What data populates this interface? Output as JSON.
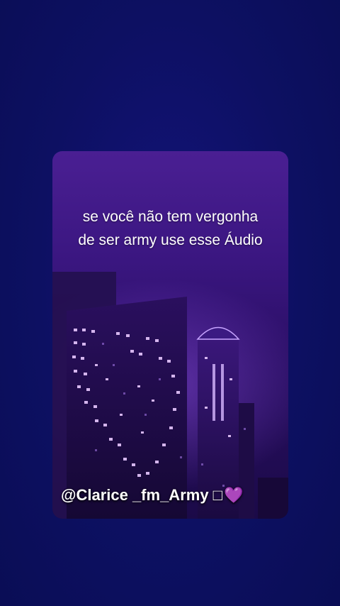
{
  "video": {
    "caption_line1": "se você não tem vergonha",
    "caption_line2": "de ser army use esse Áudio",
    "watermark_handle": "@Clarice _fm_Army □",
    "watermark_heart": "💜",
    "scene": "purple-night-skyscraper-with-heart-shaped-lit-windows",
    "colors": {
      "background": "#0b0f5c",
      "card_top": "#4a1f93",
      "card_bottom": "#1b0a48",
      "window_light": "#e8c8ff"
    }
  }
}
